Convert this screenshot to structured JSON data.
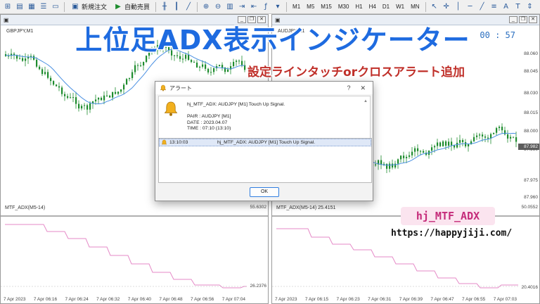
{
  "toolbar": {
    "new_order": "新規注文",
    "auto_trade": "自動売買",
    "timeframes": [
      "M1",
      "M5",
      "M15",
      "M30",
      "H1",
      "H4",
      "D1",
      "W1",
      "MN"
    ]
  },
  "left_chart": {
    "symbol": "GBPJPY,M1",
    "indicator_label": "MTF_ADX(M5-14)",
    "indicator_top_value": "55.6302",
    "indicator_bottom_value": "26.2376",
    "time_labels": [
      "7 Apr 2023",
      "7 Apr 06:16",
      "7 Apr 06:24",
      "7 Apr 06:32",
      "7 Apr 06:40",
      "7 Apr 06:48",
      "7 Apr 06:56",
      "7 Apr 07:04"
    ]
  },
  "right_chart": {
    "symbol": "AUDJPY,M1",
    "timer": "00 : 57",
    "price_labels": [
      "88.060",
      "88.045",
      "88.030",
      "88.015",
      "88.000",
      "87.990",
      "87.975",
      "87.960"
    ],
    "current_price": "87.982",
    "indicator_label": "MTF_ADX(M5-14) 25.4151",
    "indicator_top_value": "50.0552",
    "indicator_bottom_value": "20.4016",
    "time_labels": [
      "7 Apr 2023",
      "7 Apr 06:15",
      "7 Apr 06:23",
      "7 Apr 06:31",
      "7 Apr 06:39",
      "7 Apr 06:47",
      "7 Apr 06:55",
      "7 Apr 07:03"
    ]
  },
  "overlay": {
    "headline": "上位足ADX表示インジケーター",
    "subline": "設定ラインタッチorクロスアラート追加",
    "tag": "hj_MTF_ADX",
    "url": "https://happyjiji.com/"
  },
  "alert_dialog": {
    "title": "アラート",
    "help": "?",
    "close": "✕",
    "message_line1": "hj_MTF_ADX: AUDJPY [M1] Touch Up Signal.",
    "pair": "PAIR : AUDJPY [M1]",
    "date": "DATE : 2023.04.07",
    "time": "TIME : 07:10 (13:10)",
    "list": [
      {
        "time": "13:10:03",
        "message": "hj_MTF_ADX: AUDJPY [M1] Touch Up Signal."
      }
    ],
    "ok_label": "OK"
  },
  "colors": {
    "bull": "#1e8c2e",
    "bear": "#1e8c2e",
    "ma": "#4a90e2",
    "adx": "#e58ac7",
    "headline": "#1e6be0",
    "subline": "#c0302a"
  }
}
